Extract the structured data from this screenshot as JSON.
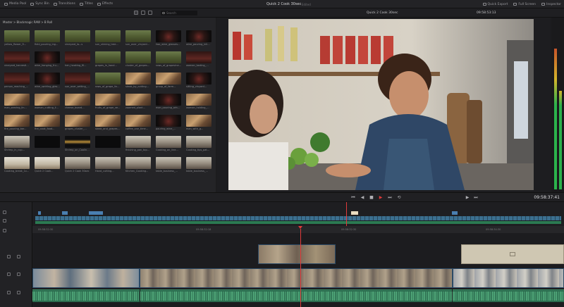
{
  "topbar": {
    "tools": [
      "Media Pool",
      "Sync Bin",
      "Transitions",
      "Titles",
      "Effects"
    ],
    "title": "Quick 2 Cook 30sec",
    "edited": "Edited",
    "right_tools": [
      "Quick Export",
      "Full Screen",
      "Inspector"
    ]
  },
  "subbar": {
    "search_placeholder": "Search",
    "viewer_title": "Quick 2 Cook 30sec",
    "viewer_timecode": "09:58:53:13"
  },
  "media_pool": {
    "breadcrumb": "Master > Blackmagic RAW > B Roll",
    "clips": [
      {
        "label": "yellow_flower_fi...",
        "style": "t-green"
      },
      {
        "label": "field_pouring_ing...",
        "style": "t-green"
      },
      {
        "label": "vineyard_lo...s",
        "style": "t-green"
      },
      {
        "label": "sun_shining_tree...",
        "style": "t-green"
      },
      {
        "label": "sun_over_vinyard...",
        "style": "t-green"
      },
      {
        "label": "two_wine_glasses...",
        "style": "t-dark"
      },
      {
        "label": "wine_pouring_inli...",
        "style": "t-dark"
      },
      {
        "label": "vineyard_harvesting...",
        "style": "t-wine"
      },
      {
        "label": "wine_hanging_fru...",
        "style": "t-dark"
      },
      {
        "label": "hen_hooking_fil...",
        "style": "t-wine"
      },
      {
        "label": "grapes_in_hand...",
        "style": "t-green"
      },
      {
        "label": "cluster_of_grapes...",
        "style": "t-green"
      },
      {
        "label": "rows_of_grapevine...",
        "style": "t-green"
      },
      {
        "label": "woman_tasting_...",
        "style": "t-wine"
      },
      {
        "label": "person_reaching_...",
        "style": "t-wine"
      },
      {
        "label": "wine_swirling_glas...",
        "style": "t-dark"
      },
      {
        "label": "sun_over_setting_v...",
        "style": "t-wine"
      },
      {
        "label": "rows_of_grape_lin...",
        "style": "t-green"
      },
      {
        "label": "steak_by_cutting...",
        "style": "t-food"
      },
      {
        "label": "group_of_farm...",
        "style": "t-food"
      },
      {
        "label": "sitting_vinyard...",
        "style": "t-dark"
      },
      {
        "label": "man_searing_lin...",
        "style": "t-food"
      },
      {
        "label": "woman_cutting_lin...",
        "style": "t-food"
      },
      {
        "label": "cheese_board...",
        "style": "t-food"
      },
      {
        "label": "fruits_of_grape_ve...",
        "style": "t-food"
      },
      {
        "label": "zoomed_plant...",
        "style": "t-food"
      },
      {
        "label": "man_pouring_wine...",
        "style": "t-dark"
      },
      {
        "label": "woman_holding_...",
        "style": "t-food"
      },
      {
        "label": "fire_pouring_bar...",
        "style": "t-food"
      },
      {
        "label": "fire_cook_food...",
        "style": "t-food"
      },
      {
        "label": "grapes_cluster_...",
        "style": "t-food"
      },
      {
        "label": "steak_and_grapes...",
        "style": "t-food"
      },
      {
        "label": "coffee_one_time...",
        "style": "t-food"
      },
      {
        "label": "pouring_wine_...",
        "style": "t-dark"
      },
      {
        "label": "man_with_g...",
        "style": "t-food"
      },
      {
        "label": "Shrimp_in_cup...",
        "style": "t-kitchen"
      },
      {
        "label": "",
        "style": "t-black"
      },
      {
        "label": "Shrimp_on_Cooling...",
        "style": "t-gold"
      },
      {
        "label": "",
        "style": "t-black"
      },
      {
        "label": "finishing_pan_top...",
        "style": "t-kitchen"
      },
      {
        "label": "Cooking_on_line...",
        "style": "t-kitchen"
      },
      {
        "label": "Cooking_tips_pat...",
        "style": "t-kitchen"
      },
      {
        "label": "Cooking_break_1x...",
        "style": "t-bright"
      },
      {
        "label": "Quick 2 Cook...",
        "style": "t-bright"
      },
      {
        "label": "Quick 2 Cook 30sec",
        "style": "t-kitchen"
      },
      {
        "label": "Hand_cutting...",
        "style": "t-kitchen"
      },
      {
        "label": "Kitchen_Cooking...",
        "style": "t-kitchen"
      },
      {
        "label": "table_business_...",
        "style": "t-kitchen"
      },
      {
        "label": "table_business_...",
        "style": "t-kitchen"
      }
    ]
  },
  "transport": {
    "timecode": "09:58:37:41"
  },
  "timeline": {
    "ruler_marks": [
      "09:58:32:30",
      "09:58:32:18",
      "09:58:32:30",
      "09:58:34:30"
    ]
  },
  "colors": {
    "accent": "#e03a3a",
    "video_clip": "#3b5b78",
    "audio_clip": "#2b6b4e",
    "meter_green": "#2bb24c",
    "meter_yellow": "#d3b52b"
  }
}
